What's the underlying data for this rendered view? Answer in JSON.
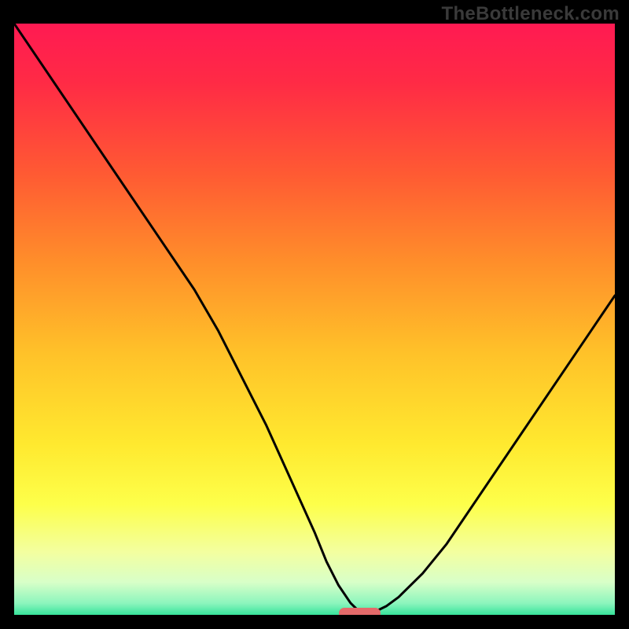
{
  "watermark": "TheBottleneck.com",
  "chart_data": {
    "type": "line",
    "title": "",
    "xlabel": "",
    "ylabel": "",
    "xlim": [
      0,
      100
    ],
    "ylim": [
      0,
      100
    ],
    "x": [
      0,
      8,
      16,
      24,
      30,
      34,
      38,
      42,
      46,
      50,
      52,
      54,
      56,
      57.5,
      60,
      62,
      64,
      68,
      72,
      76,
      80,
      84,
      88,
      92,
      96,
      100
    ],
    "values": [
      100,
      88,
      76,
      64,
      55,
      48,
      40,
      32,
      23,
      14,
      9,
      5,
      2,
      0.5,
      0.5,
      1.5,
      3,
      7,
      12,
      18,
      24,
      30,
      36,
      42,
      48,
      54
    ],
    "optimal_marker": {
      "x_start": 54,
      "x_end": 61,
      "y": 0.2
    },
    "gradient_stops": [
      {
        "pos": 0.0,
        "color": "#ff1a52"
      },
      {
        "pos": 0.1,
        "color": "#ff2b45"
      },
      {
        "pos": 0.25,
        "color": "#ff5a33"
      },
      {
        "pos": 0.4,
        "color": "#ff8f2a"
      },
      {
        "pos": 0.55,
        "color": "#ffc229"
      },
      {
        "pos": 0.7,
        "color": "#ffe92f"
      },
      {
        "pos": 0.8,
        "color": "#fdff4a"
      },
      {
        "pos": 0.88,
        "color": "#f3ffa0"
      },
      {
        "pos": 0.93,
        "color": "#d8ffc8"
      },
      {
        "pos": 0.965,
        "color": "#8cf5bd"
      },
      {
        "pos": 0.985,
        "color": "#34e39a"
      },
      {
        "pos": 1.0,
        "color": "#0fd884"
      }
    ]
  }
}
